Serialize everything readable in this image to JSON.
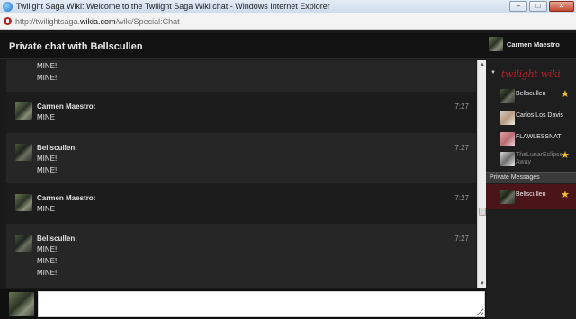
{
  "window": {
    "title": "Twilight Saga Wiki: Welcome to the Twilight Saga Wiki chat - Windows Internet Explorer",
    "buttons": {
      "minimize": "–",
      "maximize": "□",
      "close": "✕"
    }
  },
  "address_bar": {
    "url_prefix": "http://twilightsaga.",
    "url_domain": "wikia.com",
    "url_path": "/wiki/Special:Chat"
  },
  "chat": {
    "title": "Private chat with Bellscullen",
    "current_user": "Carmen Maestro",
    "messages": [
      {
        "user": "",
        "time": "",
        "lines": [
          "MINE!",
          "MINE!"
        ]
      },
      {
        "user": "Carmen Maestro:",
        "time": "7:27",
        "lines": [
          "MINE"
        ]
      },
      {
        "user": "Bellscullen:",
        "time": "7:27",
        "lines": [
          "MINE!",
          "MINE!"
        ]
      },
      {
        "user": "Carmen Maestro:",
        "time": "7:27",
        "lines": [
          "MINE"
        ]
      },
      {
        "user": "Bellscullen:",
        "time": "7:27",
        "lines": [
          "MINE!",
          "MINE!",
          "MINE!"
        ]
      }
    ],
    "input_value": ""
  },
  "sidebar": {
    "wiki_logo": "twilight wiki",
    "users": [
      {
        "name": "Bellscullen",
        "status": "",
        "starred": true,
        "away": false,
        "icon": "avatar-bellscullen"
      },
      {
        "name": "Carlos Los Davis",
        "status": "",
        "starred": false,
        "away": false,
        "icon": "avatar-carlos"
      },
      {
        "name": "FLAWLESSNAT",
        "status": "",
        "starred": false,
        "away": false,
        "icon": "avatar-flawless"
      },
      {
        "name": "TheLunarEclipse",
        "status": "Away",
        "starred": true,
        "away": true,
        "icon": "avatar-lunar"
      }
    ],
    "private_messages_label": "Private Messages",
    "private_messages": [
      {
        "name": "Bellscullen",
        "starred": true
      }
    ]
  },
  "colors": {
    "background": "#1a1a1a",
    "accent_red": "#b01f2c",
    "star": "#f3c22b",
    "pm_highlight": "#4a1418"
  }
}
